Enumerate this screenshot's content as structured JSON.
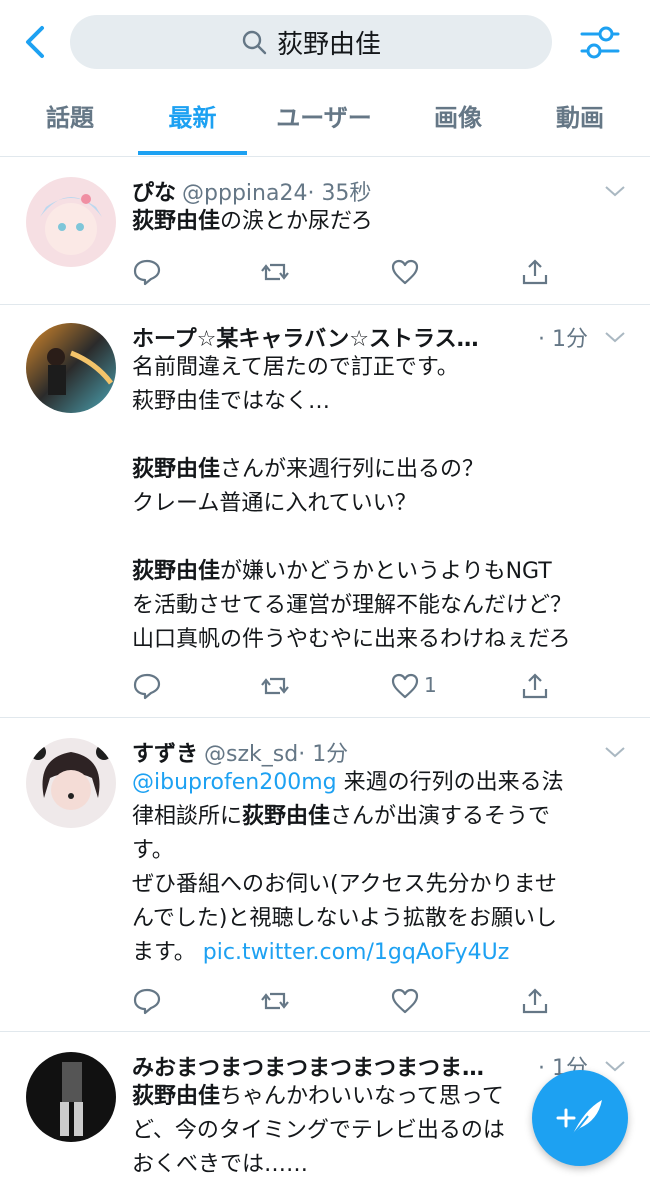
{
  "search": {
    "query": "荻野由佳"
  },
  "tabs": [
    {
      "label": "話題"
    },
    {
      "label": "最新"
    },
    {
      "label": "ユーザー"
    },
    {
      "label": "画像"
    },
    {
      "label": "動画"
    }
  ],
  "active_tab": "最新",
  "accent_color": "#1da1f2",
  "tweets": [
    {
      "name": "ぴな",
      "handle": "@pppina24",
      "time": "· 35秒",
      "line1_hl": "荻野由佳",
      "line1_rest": "の涙とか尿だろ",
      "like_count": ""
    },
    {
      "name": "ホープ☆某キャラバン☆ストラス…",
      "time": "· 1分",
      "l1": "名前間違えて居たので訂正です。",
      "l2": "萩野由佳ではなく…",
      "l3_hl": "荻野由佳",
      "l3_rest": "さんが来週行列に出るの？",
      "l4": "クレーム普通に入れていい？",
      "l5_hl": "荻野由佳",
      "l5_rest": "が嫌いかどうかというよりもNGT",
      "l6": "を活動させてる運営が理解不能なんだけど？",
      "l7": "山口真帆の件うやむやに出来るわけねぇだろ",
      "like_count": "1"
    },
    {
      "name": "すずき",
      "handle": "@szk_sd",
      "time": "· 1分",
      "l1_link": "@ibuprofen200mg",
      "l1_rest": " 来週の行列の出来る法",
      "l2_pre": "律相談所に",
      "l2_hl": "荻野由佳",
      "l2_rest": "さんが出演するそうで",
      "l3": "す。",
      "l4": "ぜひ番組へのお伺い(アクセス先分かりませ",
      "l5": "んでした)と視聴しないよう拡散をお願いし",
      "l6_pre": "ます。 ",
      "l6_link": "pic.twitter.com/1gqAoFy4Uz",
      "like_count": ""
    },
    {
      "name": "みおまつまつまつまつまつまつま…",
      "time": "· 1分",
      "l1_hl": "荻野由佳",
      "l1_rest": "ちゃんかわいいなって思って",
      "l2": "ど、今のタイミングでテレビ出るのは",
      "l3": "おくべきでは……"
    }
  ]
}
